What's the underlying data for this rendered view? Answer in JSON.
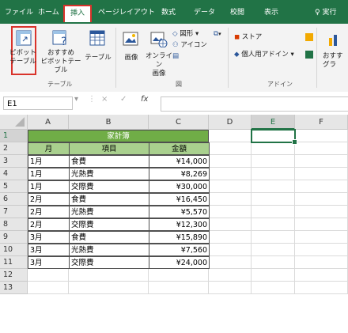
{
  "tabs": [
    "ファイル",
    "ホーム",
    "挿入",
    "ページレイアウト",
    "数式",
    "データ",
    "校閲",
    "表示",
    "♀ 実行"
  ],
  "active_tab": "挿入",
  "ribbon": {
    "pivot_table": [
      "ピボット",
      "テーブル"
    ],
    "recommended_pivot": [
      "おすすめ",
      "ピボットテーブル"
    ],
    "table": "テーブル",
    "group_tables": "テーブル",
    "image": "画像",
    "online_image": [
      "オンライン",
      "画像"
    ],
    "shapes": "図形 ▾",
    "icons": "アイコン",
    "group_illust": "図",
    "store": "ストア",
    "personal_addins": "個人用アドイン ▾",
    "group_addins": "アドイン",
    "recommended_charts": [
      "おすす",
      "グラ"
    ]
  },
  "formula_bar": {
    "namebox": "E1",
    "cancel": "×",
    "enter": "✓",
    "fx": "fx",
    "value": ""
  },
  "columns": [
    "A",
    "B",
    "C",
    "D",
    "E",
    "F"
  ],
  "rows": [
    "1",
    "2",
    "3",
    "4",
    "5",
    "6",
    "7",
    "8",
    "9",
    "10",
    "11",
    "12",
    "13"
  ],
  "sheet": {
    "title": "家計簿",
    "headers": [
      "月",
      "項目",
      "金額"
    ],
    "data": [
      [
        "1月",
        "食費",
        "¥14,000"
      ],
      [
        "1月",
        "光熱費",
        "¥8,269"
      ],
      [
        "1月",
        "交際費",
        "¥30,000"
      ],
      [
        "2月",
        "食費",
        "¥16,450"
      ],
      [
        "2月",
        "光熱費",
        "¥5,570"
      ],
      [
        "2月",
        "交際費",
        "¥12,300"
      ],
      [
        "3月",
        "食費",
        "¥15,890"
      ],
      [
        "3月",
        "光熱費",
        "¥7,560"
      ],
      [
        "3月",
        "交際費",
        "¥24,000"
      ]
    ]
  },
  "colors": {
    "excel_green": "#217346",
    "title_fill": "#70ad47",
    "header_fill": "#a9d08e",
    "highlight": "#d9332b"
  }
}
